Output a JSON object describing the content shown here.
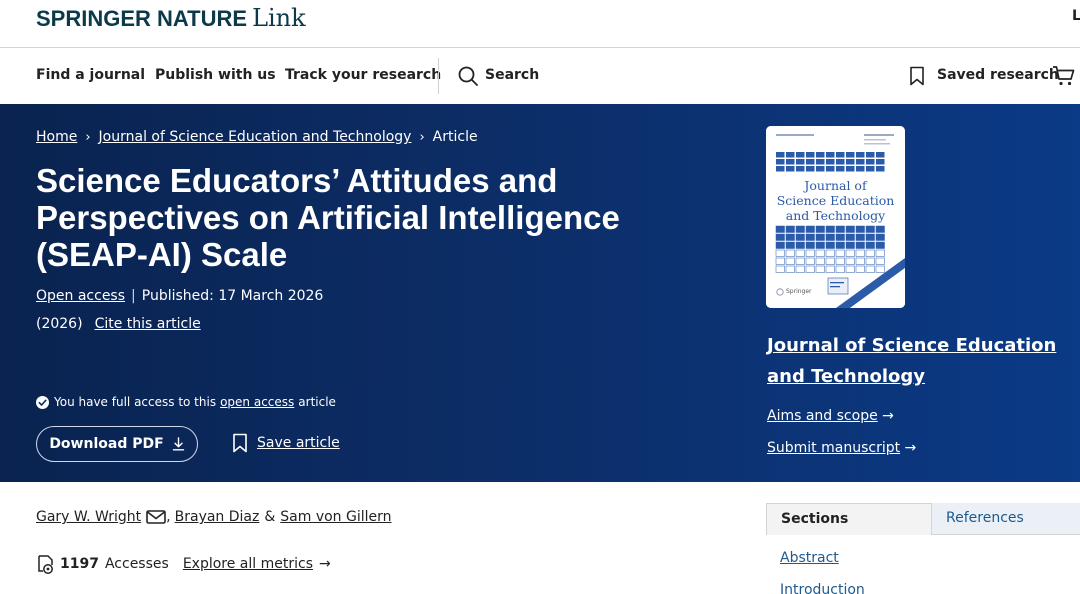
{
  "brand": {
    "name_bold": "SPRINGER NATURE",
    "name_light": "Link",
    "right_cutoff": "L"
  },
  "nav": {
    "find_journal": "Find a journal",
    "publish": "Publish with us",
    "track": "Track your research",
    "search": "Search",
    "saved": "Saved research"
  },
  "breadcrumb": {
    "home": "Home",
    "journal": "Journal of Science Education and Technology",
    "current": "Article"
  },
  "article": {
    "title": "Science Educators’ Attitudes and Perspectives on Artificial Intelligence (SEAP-AI) Scale",
    "open_access": "Open access",
    "published": "Published: 17 March 2026",
    "year": "(2026)",
    "cite": "Cite this article"
  },
  "access_note": {
    "prefix": "You have full access to this",
    "link": "open access",
    "suffix": "article"
  },
  "actions": {
    "download": "Download PDF",
    "save": "Save article"
  },
  "cover": {
    "title_line1": "Journal of",
    "title_line2": "Science Education",
    "title_line3": "and Technology",
    "publisher": "Springer"
  },
  "journal_panel": {
    "journal_name": "Journal of Science Education and Technology",
    "aims": "Aims and scope",
    "submit": "Submit manuscript"
  },
  "authors": {
    "a1": "Gary W. Wright",
    "sep1": ",",
    "a2": "Brayan Diaz",
    "amp": "&",
    "a3": "Sam von Gillern"
  },
  "metrics": {
    "accesses_count": "1197",
    "accesses_label": "Accesses",
    "explore": "Explore all metrics"
  },
  "sidebar_tabs": {
    "sections": "Sections",
    "references": "References"
  },
  "toc": {
    "abstract": "Abstract",
    "introduction": "Introduction"
  },
  "colors": {
    "hero_dark": "#0a2350",
    "hero_light": "#0b3a86",
    "brand": "#0c3a4a",
    "link": "#1f5a8c"
  }
}
